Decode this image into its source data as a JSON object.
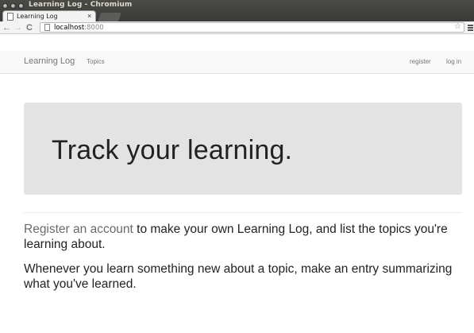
{
  "window": {
    "title": "Learning Log - Chromium"
  },
  "tab": {
    "title": "Learning Log",
    "close": "×"
  },
  "toolbar": {
    "back": "←",
    "forward": "→",
    "reload": "C",
    "url_host": "localhost",
    "url_port": ":8000",
    "star": "☆"
  },
  "navbar": {
    "brand": "Learning Log",
    "topics": "Topics",
    "register": "register",
    "login": "log in"
  },
  "jumbotron": {
    "heading": "Track your learning."
  },
  "content": {
    "p1_link": "Register an account",
    "p1_rest": " to make your own Learning Log, and list the topics you're learning about.",
    "p2": "Whenever you learn something new about a topic, make an entry summarizing what you've learned."
  }
}
